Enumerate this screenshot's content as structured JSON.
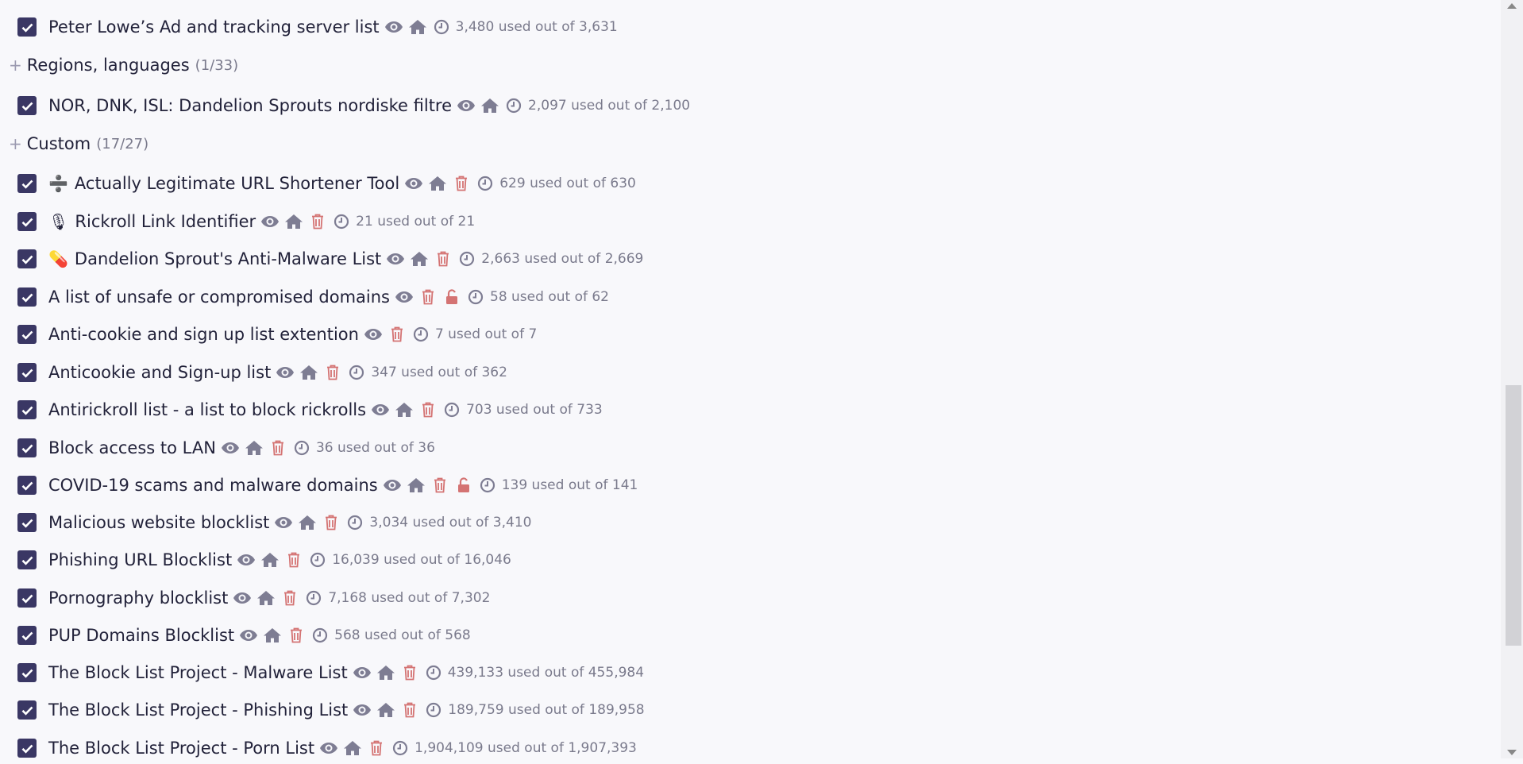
{
  "colors": {
    "checkbox": "#3a3764",
    "icon_gray": "#7e7d93",
    "icon_red": "#d47373",
    "background": "#f8f8fb"
  },
  "rows": [
    {
      "type": "item",
      "checked": true,
      "emoji": "",
      "name": "Peter Lowe’s Ad and tracking server list",
      "icons": [
        "eye-icon",
        "home-icon",
        "clock-icon"
      ],
      "stat": "3,480 used out of 3,631"
    },
    {
      "type": "group",
      "toggle": "+",
      "name": "Regions, languages",
      "count": "(1/33)"
    },
    {
      "type": "item",
      "checked": true,
      "emoji": "",
      "name": "NOR, DNK, ISL: Dandelion Sprouts nordiske filtre",
      "icons": [
        "eye-icon",
        "home-icon",
        "clock-icon"
      ],
      "stat": "2,097 used out of 2,100"
    },
    {
      "type": "group",
      "toggle": "+",
      "name": "Custom",
      "count": "(17/27)"
    },
    {
      "type": "item",
      "checked": true,
      "emoji": "➗",
      "name": "Actually Legitimate URL Shortener Tool",
      "icons": [
        "eye-icon",
        "home-icon",
        "trash-icon",
        "clock-icon"
      ],
      "stat": "629 used out of 630"
    },
    {
      "type": "item",
      "checked": true,
      "emoji": "🎙",
      "name": "Rickroll Link Identifier",
      "icons": [
        "eye-icon",
        "home-icon",
        "trash-icon",
        "clock-icon"
      ],
      "stat": "21 used out of 21"
    },
    {
      "type": "item",
      "checked": true,
      "emoji": "💊",
      "name": "Dandelion Sprout's Anti-Malware List",
      "icons": [
        "eye-icon",
        "home-icon",
        "trash-icon",
        "clock-icon"
      ],
      "stat": "2,663 used out of 2,669"
    },
    {
      "type": "item",
      "checked": true,
      "emoji": "",
      "name": "A list of unsafe or compromised domains",
      "icons": [
        "eye-icon",
        "trash-icon",
        "unlock-icon",
        "clock-icon"
      ],
      "stat": "58 used out of 62"
    },
    {
      "type": "item",
      "checked": true,
      "emoji": "",
      "name": "Anti-cookie and sign up list extention",
      "icons": [
        "eye-icon",
        "trash-icon",
        "clock-icon"
      ],
      "stat": "7 used out of 7"
    },
    {
      "type": "item",
      "checked": true,
      "emoji": "",
      "name": "Anticookie and Sign-up list",
      "icons": [
        "eye-icon",
        "home-icon",
        "trash-icon",
        "clock-icon"
      ],
      "stat": "347 used out of 362"
    },
    {
      "type": "item",
      "checked": true,
      "emoji": "",
      "name": "Antirickroll list - a list to block rickrolls",
      "icons": [
        "eye-icon",
        "home-icon",
        "trash-icon",
        "clock-icon"
      ],
      "stat": "703 used out of 733"
    },
    {
      "type": "item",
      "checked": true,
      "emoji": "",
      "name": "Block access to LAN",
      "icons": [
        "eye-icon",
        "home-icon",
        "trash-icon",
        "clock-icon"
      ],
      "stat": "36 used out of 36"
    },
    {
      "type": "item",
      "checked": true,
      "emoji": "",
      "name": "COVID-19 scams and malware domains",
      "icons": [
        "eye-icon",
        "home-icon",
        "trash-icon",
        "unlock-icon",
        "clock-icon"
      ],
      "stat": "139 used out of 141"
    },
    {
      "type": "item",
      "checked": true,
      "emoji": "",
      "name": "Malicious website blocklist",
      "icons": [
        "eye-icon",
        "home-icon",
        "trash-icon",
        "clock-icon"
      ],
      "stat": "3,034 used out of 3,410"
    },
    {
      "type": "item",
      "checked": true,
      "emoji": "",
      "name": "Phishing URL Blocklist",
      "icons": [
        "eye-icon",
        "home-icon",
        "trash-icon",
        "clock-icon"
      ],
      "stat": "16,039 used out of 16,046"
    },
    {
      "type": "item",
      "checked": true,
      "emoji": "",
      "name": "Pornography blocklist",
      "icons": [
        "eye-icon",
        "home-icon",
        "trash-icon",
        "clock-icon"
      ],
      "stat": "7,168 used out of 7,302"
    },
    {
      "type": "item",
      "checked": true,
      "emoji": "",
      "name": "PUP Domains Blocklist",
      "icons": [
        "eye-icon",
        "home-icon",
        "trash-icon",
        "clock-icon"
      ],
      "stat": "568 used out of 568"
    },
    {
      "type": "item",
      "checked": true,
      "emoji": "",
      "name": "The Block List Project - Malware List",
      "icons": [
        "eye-icon",
        "home-icon",
        "trash-icon",
        "clock-icon"
      ],
      "stat": "439,133 used out of 455,984"
    },
    {
      "type": "item",
      "checked": true,
      "emoji": "",
      "name": "The Block List Project - Phishing List",
      "icons": [
        "eye-icon",
        "home-icon",
        "trash-icon",
        "clock-icon"
      ],
      "stat": "189,759 used out of 189,958"
    },
    {
      "type": "item",
      "checked": true,
      "emoji": "",
      "name": "The Block List Project - Porn List",
      "icons": [
        "eye-icon",
        "home-icon",
        "trash-icon",
        "clock-icon"
      ],
      "stat": "1,904,109 used out of 1,907,393"
    }
  ]
}
